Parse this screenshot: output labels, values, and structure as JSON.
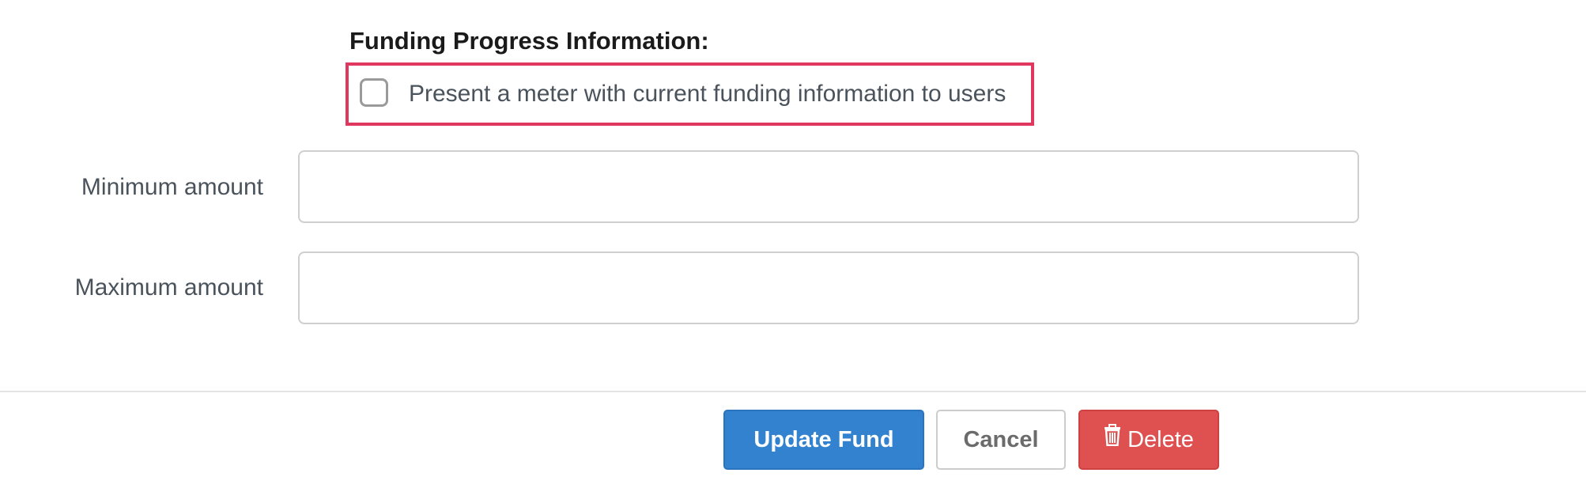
{
  "funding": {
    "section_title": "Funding Progress Information:",
    "meter_checkbox_label": "Present a meter with current funding information to users",
    "meter_checked": false
  },
  "fields": {
    "minimum_label": "Minimum amount",
    "minimum_value": "",
    "maximum_label": "Maximum amount",
    "maximum_value": ""
  },
  "actions": {
    "update_label": "Update Fund",
    "cancel_label": "Cancel",
    "delete_label": "Delete",
    "delete_icon": "trash-icon"
  },
  "colors": {
    "highlight_border": "#e0375f",
    "primary": "#3282d0",
    "danger": "#df5150"
  }
}
